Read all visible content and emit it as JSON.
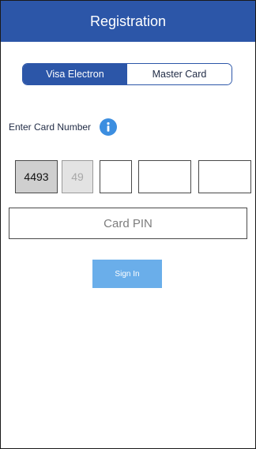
{
  "header": {
    "title": "Registration"
  },
  "card_type": {
    "options": [
      "Visa Electron",
      "Master Card"
    ],
    "selected": "Visa Electron"
  },
  "card_number": {
    "label": "Enter Card Number",
    "info_icon": "info-icon",
    "segments": [
      "4493",
      "49",
      "",
      "",
      ""
    ]
  },
  "pin": {
    "placeholder": "Card PIN"
  },
  "actions": {
    "sign_in_label": "Sign In"
  },
  "colors": {
    "primary": "#2c56a8",
    "info": "#3c8ee0",
    "button": "#6aaeea"
  }
}
